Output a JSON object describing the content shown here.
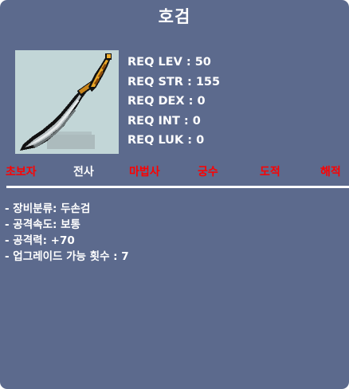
{
  "item": {
    "name": "호검",
    "icon": "sword-icon"
  },
  "requirements": [
    "REQ LEV : 50",
    "REQ STR : 155",
    "REQ DEX : 0",
    "REQ INT : 0",
    "REQ LUK : 0"
  ],
  "jobs": [
    {
      "label": "초보자",
      "allowed": false
    },
    {
      "label": "전사",
      "allowed": true
    },
    {
      "label": "마법사",
      "allowed": false
    },
    {
      "label": "궁수",
      "allowed": false
    },
    {
      "label": "도적",
      "allowed": false
    },
    {
      "label": "해적",
      "allowed": false
    }
  ],
  "stats": [
    "- 장비분류: 두손검",
    "- 공격속도: 보통",
    "- 공격력: +70",
    "- 업그레이드 가능 횟수 : 7"
  ],
  "colors": {
    "background": "#5c6a8d",
    "text": "#ffffff",
    "job_unavailable": "#ff0000",
    "icon_background": "#c2d6d7"
  }
}
